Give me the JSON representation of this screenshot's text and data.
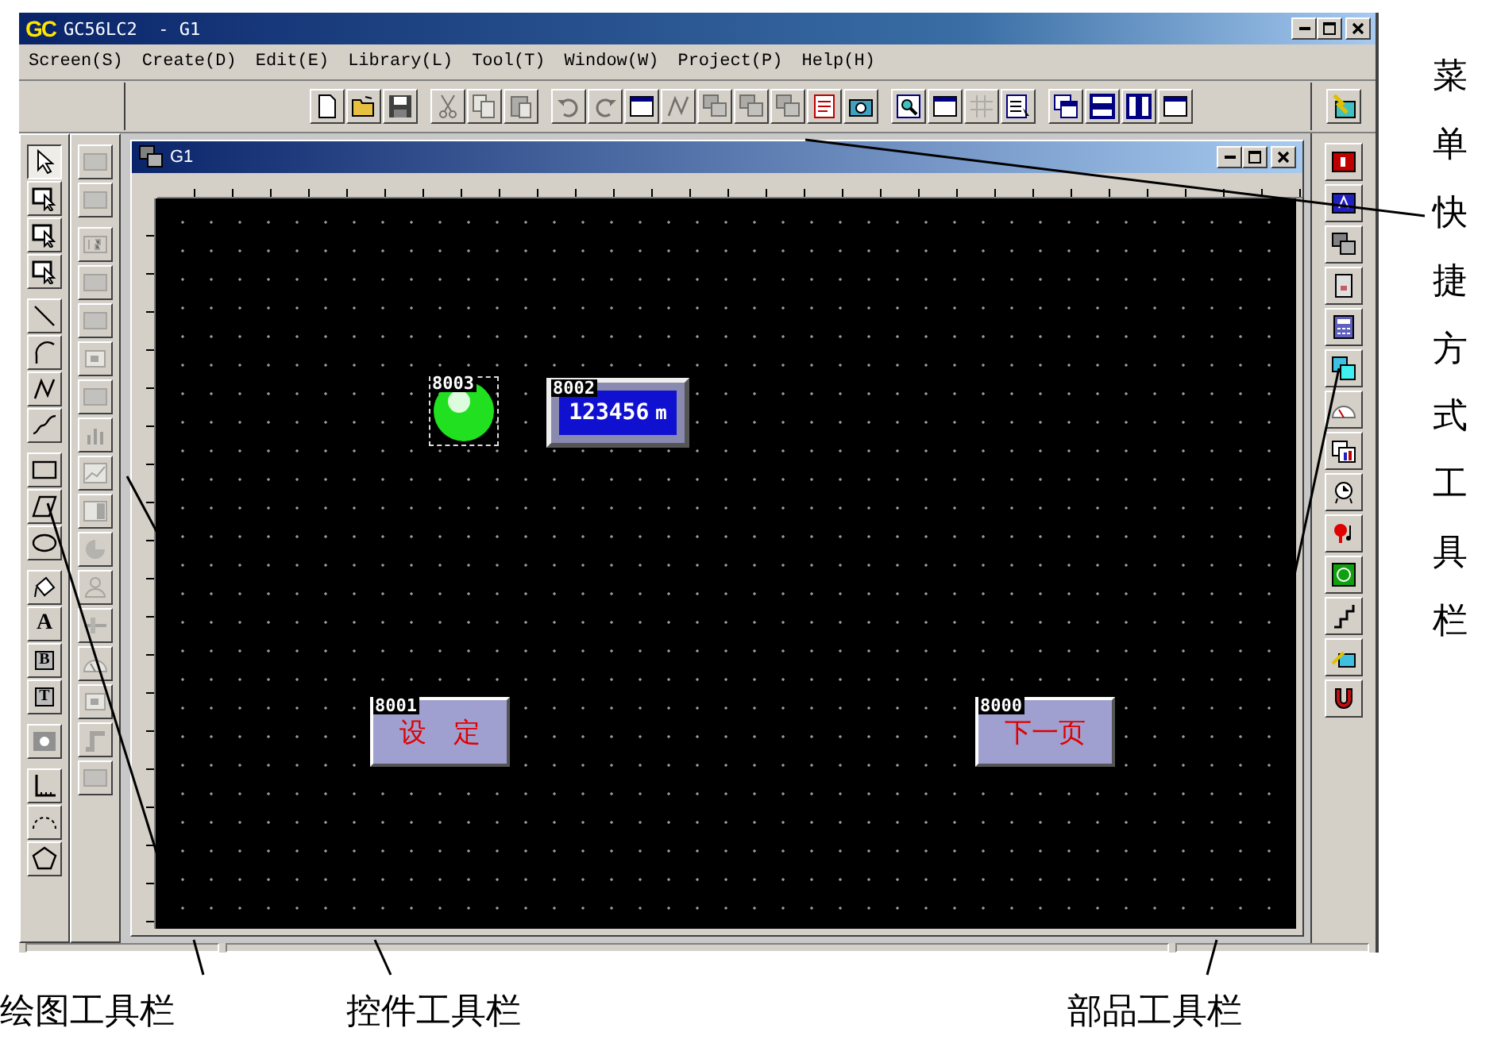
{
  "window": {
    "logo": "GC",
    "title": "GC56LC2  - G1"
  },
  "menu": [
    {
      "label": "Screen(S)"
    },
    {
      "label": "Create(D)"
    },
    {
      "label": "Edit(E)"
    },
    {
      "label": "Library(L)"
    },
    {
      "label": "Tool(T)"
    },
    {
      "label": "Window(W)"
    },
    {
      "label": "Project(P)"
    },
    {
      "label": "Help(H)"
    }
  ],
  "main_toolbar": {
    "groups": [
      [
        {
          "disabled": false
        },
        {
          "disabled": false
        },
        {
          "disabled": false
        }
      ],
      [
        {
          "disabled": true
        },
        {
          "disabled": true
        },
        {
          "disabled": true
        }
      ],
      [
        {
          "disabled": true
        },
        {
          "disabled": true
        },
        {
          "disabled": false
        },
        {
          "disabled": true
        },
        {
          "disabled": true
        },
        {
          "disabled": true
        },
        {
          "disabled": true
        },
        {
          "disabled": false
        },
        {
          "disabled": false
        }
      ],
      [
        {
          "disabled": false
        },
        {
          "disabled": false
        },
        {
          "disabled": true
        },
        {
          "disabled": false
        }
      ],
      [
        {
          "disabled": false
        },
        {
          "disabled": false
        },
        {
          "disabled": false
        },
        {
          "disabled": false
        }
      ]
    ]
  },
  "drawing_toolbar": {
    "groups": [
      [
        {
          "selected": true
        },
        {
          "selected": false
        },
        {
          "selected": false
        },
        {
          "selected": false
        }
      ],
      [
        {
          "selected": false
        },
        {
          "selected": false
        },
        {
          "selected": false
        },
        {
          "selected": false
        }
      ],
      [
        {
          "selected": false
        },
        {
          "selected": false
        },
        {
          "selected": false
        }
      ],
      [
        {
          "selected": false
        },
        {
          "selected": false,
          "glyph": "A"
        },
        {
          "selected": false,
          "glyph": "B"
        },
        {
          "selected": false,
          "glyph": "T"
        }
      ],
      [
        {
          "selected": false
        }
      ],
      [
        {
          "selected": false
        },
        {
          "selected": false
        },
        {
          "selected": false
        }
      ]
    ]
  },
  "control_toolbar": {
    "buttons": [
      {
        "disabled": true
      },
      {
        "disabled": true
      },
      {
        "disabled": true
      },
      {
        "disabled": true
      },
      {
        "disabled": true
      },
      {
        "disabled": true
      },
      {
        "disabled": true
      },
      {
        "disabled": true
      },
      {
        "disabled": true
      },
      {
        "disabled": true
      },
      {
        "disabled": true
      },
      {
        "disabled": true
      },
      {
        "disabled": true
      },
      {
        "disabled": true
      },
      {
        "disabled": true
      },
      {
        "disabled": true
      },
      {
        "disabled": true
      }
    ]
  },
  "parts_toolbar": {
    "buttons": [
      {
        "disabled": false
      },
      {
        "disabled": false
      },
      {
        "disabled": false
      },
      {
        "disabled": false
      },
      {
        "disabled": false
      },
      {
        "disabled": false
      },
      {
        "disabled": false
      },
      {
        "disabled": false
      },
      {
        "disabled": false
      },
      {
        "disabled": false
      },
      {
        "disabled": false
      },
      {
        "disabled": false
      },
      {
        "disabled": false
      },
      {
        "disabled": false
      }
    ]
  },
  "child_window": {
    "title": "G1"
  },
  "canvas": {
    "objects": [
      {
        "kind": "lamp",
        "id": "8003",
        "on": true
      },
      {
        "kind": "numeric",
        "id": "8002",
        "value": "123456",
        "unit": "m"
      },
      {
        "kind": "button",
        "id": "8001",
        "label": "设　定"
      },
      {
        "kind": "button",
        "id": "8000",
        "label": "下一页"
      }
    ]
  },
  "annotations": {
    "side_label": "菜单快捷方式工具栏",
    "bottom_labels": [
      "绘图工具栏",
      "控件工具栏",
      "部品工具栏"
    ]
  }
}
